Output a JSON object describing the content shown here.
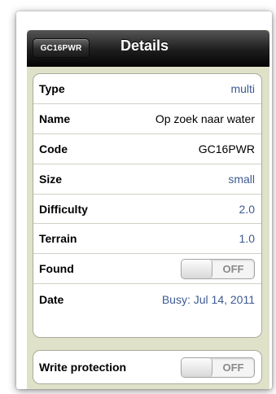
{
  "navbar": {
    "back_label": "GC16PWR",
    "title": "Details"
  },
  "details": [
    {
      "label": "Type",
      "value": "multi",
      "color": "#3d5a93"
    },
    {
      "label": "Name",
      "value": "Op zoek naar water",
      "color": "#000000"
    },
    {
      "label": "Code",
      "value": "GC16PWR",
      "color": "#000000"
    },
    {
      "label": "Size",
      "value": "small",
      "color": "#3d5a93"
    },
    {
      "label": "Difficulty",
      "value": "2.0",
      "color": "#3d5a93"
    },
    {
      "label": "Terrain",
      "value": "1.0",
      "color": "#3d5a93"
    },
    {
      "label": "Found",
      "toggle": "OFF"
    },
    {
      "label": "Date",
      "value": "Busy: Jul 14, 2011",
      "color": "#3d5a93"
    }
  ],
  "protection": {
    "label": "Write protection",
    "toggle": "OFF"
  },
  "colors": {
    "navbar": "#1e1e1e",
    "background": "#dfe2c9",
    "value_blue": "#3d5a93"
  }
}
